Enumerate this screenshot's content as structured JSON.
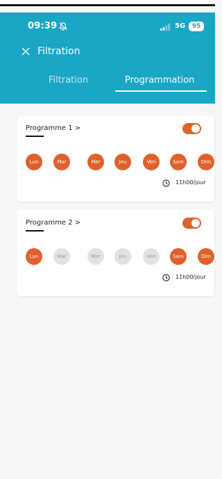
{
  "status_bar": {
    "time": "09:39",
    "network": "5G",
    "battery": "95"
  },
  "app_bar": {
    "title": "Filtration",
    "close_icon": "close-icon"
  },
  "tabs": [
    {
      "label": "Filtration",
      "active": false
    },
    {
      "label": "Programmation",
      "active": true
    }
  ],
  "colors": {
    "header": "#1aa6c5",
    "accent": "#e0612b",
    "day_off": "#e2e2e2"
  },
  "programmes": [
    {
      "title": "Programme 1 >",
      "enabled": true,
      "days": [
        {
          "label": "Lun",
          "active": true
        },
        {
          "label": "Mar",
          "active": true
        },
        {
          "label": "Mer",
          "active": true
        },
        {
          "label": "Jeu",
          "active": true
        },
        {
          "label": "Ven",
          "active": true
        },
        {
          "label": "Sam",
          "active": true
        },
        {
          "label": "Dim",
          "active": true
        }
      ],
      "duration": "11h00/jour"
    },
    {
      "title": "Programme 2 >",
      "enabled": true,
      "days": [
        {
          "label": "Lun",
          "active": true
        },
        {
          "label": "Mar",
          "active": false
        },
        {
          "label": "Mer",
          "active": false
        },
        {
          "label": "Jeu",
          "active": false
        },
        {
          "label": "Ven",
          "active": false
        },
        {
          "label": "Sam",
          "active": true
        },
        {
          "label": "Dim",
          "active": true
        }
      ],
      "duration": "11h00/jour"
    }
  ]
}
